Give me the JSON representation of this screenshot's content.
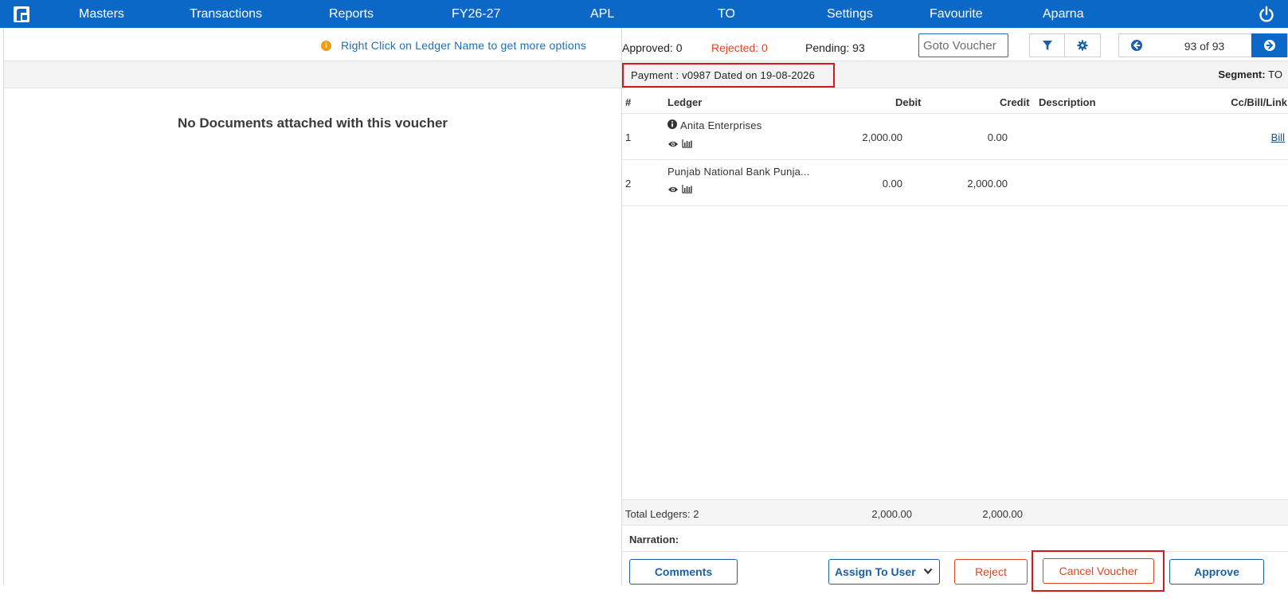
{
  "nav": {
    "items": [
      "Masters",
      "Transactions",
      "Reports",
      "FY26-27",
      "APL",
      "TO",
      "Settings",
      "Favourite",
      "Aparna"
    ]
  },
  "left": {
    "hint": "Right Click on Ledger Name to get more options",
    "no_docs": "No Documents attached with this voucher"
  },
  "status": {
    "approved": "Approved: 0",
    "rejected": "Rejected: 0",
    "pending": "Pending: 93",
    "goto_placeholder": "Goto Voucher",
    "page": "93 of 93"
  },
  "voucher": {
    "title": "Payment : v0987  Dated on  19-08-2026",
    "segment_label": "Segment:",
    "segment_value": "TO"
  },
  "table": {
    "headers": {
      "num": "#",
      "ledger": "Ledger",
      "debit": "Debit",
      "credit": "Credit",
      "description": "Description",
      "link": "Cc/Bill/Link"
    },
    "rows": [
      {
        "num": "1",
        "ledger": "Anita Enterprises",
        "debit": "2,000.00",
        "credit": "0.00",
        "description": "",
        "link": "Bill"
      },
      {
        "num": "2",
        "ledger": "Punjab National Bank Punja...",
        "debit": "0.00",
        "credit": "2,000.00",
        "description": "",
        "link": ""
      }
    ],
    "totals": {
      "label": "Total Ledgers: 2",
      "debit": "2,000.00",
      "credit": "2,000.00"
    },
    "narration_label": "Narration:"
  },
  "actions": {
    "comments": "Comments",
    "assign": "Assign To User",
    "reject": "Reject",
    "cancel": "Cancel Voucher",
    "approve": "Approve"
  },
  "colors": {
    "nav_bg": "#0b68c6",
    "link_blue": "#1a6fbf",
    "reject_red": "#e0451f",
    "highlight_red": "#d9161c"
  }
}
